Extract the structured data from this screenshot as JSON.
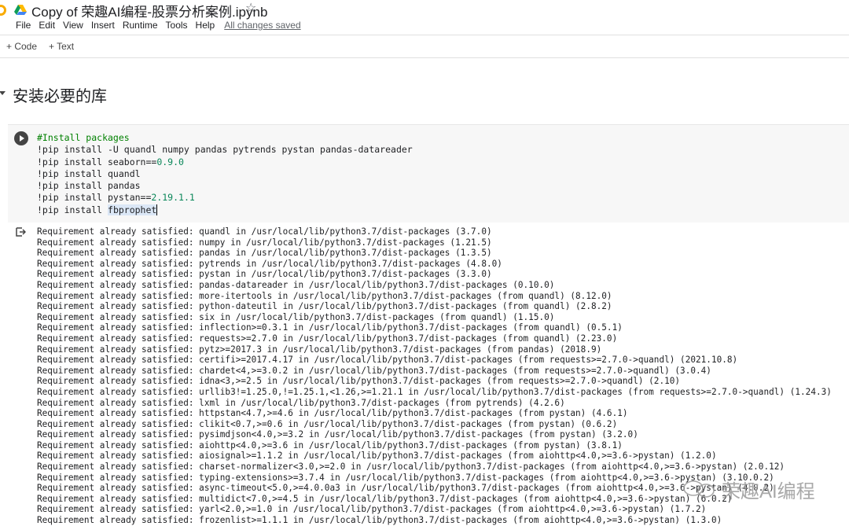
{
  "window": {
    "title": "Copy of 荣趣AI编程-股票分析案例.ipynb",
    "star_icon": "star-outline-icon"
  },
  "menu": {
    "items": [
      "File",
      "Edit",
      "View",
      "Insert",
      "Runtime",
      "Tools",
      "Help"
    ],
    "saved_status": "All changes saved"
  },
  "toolbar": {
    "code_label": "+ Code",
    "text_label": "+ Text"
  },
  "section": {
    "heading": "安装必要的库"
  },
  "code_cell": {
    "lines": [
      "#Install packages",
      "!pip install -U quandl numpy pandas pytrends pystan pandas-datareader",
      "!pip install seaborn==0.9.0",
      "!pip install quandl",
      "!pip install pandas",
      "!pip install pystan==2.19.1.1",
      "!pip install fbprophet"
    ]
  },
  "output": {
    "lines": [
      "Requirement already satisfied: quandl in /usr/local/lib/python3.7/dist-packages (3.7.0)",
      "Requirement already satisfied: numpy in /usr/local/lib/python3.7/dist-packages (1.21.5)",
      "Requirement already satisfied: pandas in /usr/local/lib/python3.7/dist-packages (1.3.5)",
      "Requirement already satisfied: pytrends in /usr/local/lib/python3.7/dist-packages (4.8.0)",
      "Requirement already satisfied: pystan in /usr/local/lib/python3.7/dist-packages (3.3.0)",
      "Requirement already satisfied: pandas-datareader in /usr/local/lib/python3.7/dist-packages (0.10.0)",
      "Requirement already satisfied: more-itertools in /usr/local/lib/python3.7/dist-packages (from quandl) (8.12.0)",
      "Requirement already satisfied: python-dateutil in /usr/local/lib/python3.7/dist-packages (from quandl) (2.8.2)",
      "Requirement already satisfied: six in /usr/local/lib/python3.7/dist-packages (from quandl) (1.15.0)",
      "Requirement already satisfied: inflection>=0.3.1 in /usr/local/lib/python3.7/dist-packages (from quandl) (0.5.1)",
      "Requirement already satisfied: requests>=2.7.0 in /usr/local/lib/python3.7/dist-packages (from quandl) (2.23.0)",
      "Requirement already satisfied: pytz>=2017.3 in /usr/local/lib/python3.7/dist-packages (from pandas) (2018.9)",
      "Requirement already satisfied: certifi>=2017.4.17 in /usr/local/lib/python3.7/dist-packages (from requests>=2.7.0->quandl) (2021.10.8)",
      "Requirement already satisfied: chardet<4,>=3.0.2 in /usr/local/lib/python3.7/dist-packages (from requests>=2.7.0->quandl) (3.0.4)",
      "Requirement already satisfied: idna<3,>=2.5 in /usr/local/lib/python3.7/dist-packages (from requests>=2.7.0->quandl) (2.10)",
      "Requirement already satisfied: urllib3!=1.25.0,!=1.25.1,<1.26,>=1.21.1 in /usr/local/lib/python3.7/dist-packages (from requests>=2.7.0->quandl) (1.24.3)",
      "Requirement already satisfied: lxml in /usr/local/lib/python3.7/dist-packages (from pytrends) (4.2.6)",
      "Requirement already satisfied: httpstan<4.7,>=4.6 in /usr/local/lib/python3.7/dist-packages (from pystan) (4.6.1)",
      "Requirement already satisfied: clikit<0.7,>=0.6 in /usr/local/lib/python3.7/dist-packages (from pystan) (0.6.2)",
      "Requirement already satisfied: pysimdjson<4.0,>=3.2 in /usr/local/lib/python3.7/dist-packages (from pystan) (3.2.0)",
      "Requirement already satisfied: aiohttp<4.0,>=3.6 in /usr/local/lib/python3.7/dist-packages (from pystan) (3.8.1)",
      "Requirement already satisfied: aiosignal>=1.1.2 in /usr/local/lib/python3.7/dist-packages (from aiohttp<4.0,>=3.6->pystan) (1.2.0)",
      "Requirement already satisfied: charset-normalizer<3.0,>=2.0 in /usr/local/lib/python3.7/dist-packages (from aiohttp<4.0,>=3.6->pystan) (2.0.12)",
      "Requirement already satisfied: typing-extensions>=3.7.4 in /usr/local/lib/python3.7/dist-packages (from aiohttp<4.0,>=3.6->pystan) (3.10.0.2)",
      "Requirement already satisfied: async-timeout<5.0,>=4.0.0a3 in /usr/local/lib/python3.7/dist-packages (from aiohttp<4.0,>=3.6->pystan) (4.0.2)",
      "Requirement already satisfied: multidict<7.0,>=4.5 in /usr/local/lib/python3.7/dist-packages (from aiohttp<4.0,>=3.6->pystan) (6.0.2)",
      "Requirement already satisfied: yarl<2.0,>=1.0 in /usr/local/lib/python3.7/dist-packages (from aiohttp<4.0,>=3.6->pystan) (1.7.2)",
      "Requirement already satisfied: frozenlist>=1.1.1 in /usr/local/lib/python3.7/dist-packages (from aiohttp<4.0,>=3.6->pystan) (1.3.0)"
    ]
  },
  "watermark": {
    "text": "荣趣AI编程"
  },
  "colors": {
    "comment": "#008000",
    "number": "#098658",
    "cell_bg": "#f7f7f7"
  }
}
